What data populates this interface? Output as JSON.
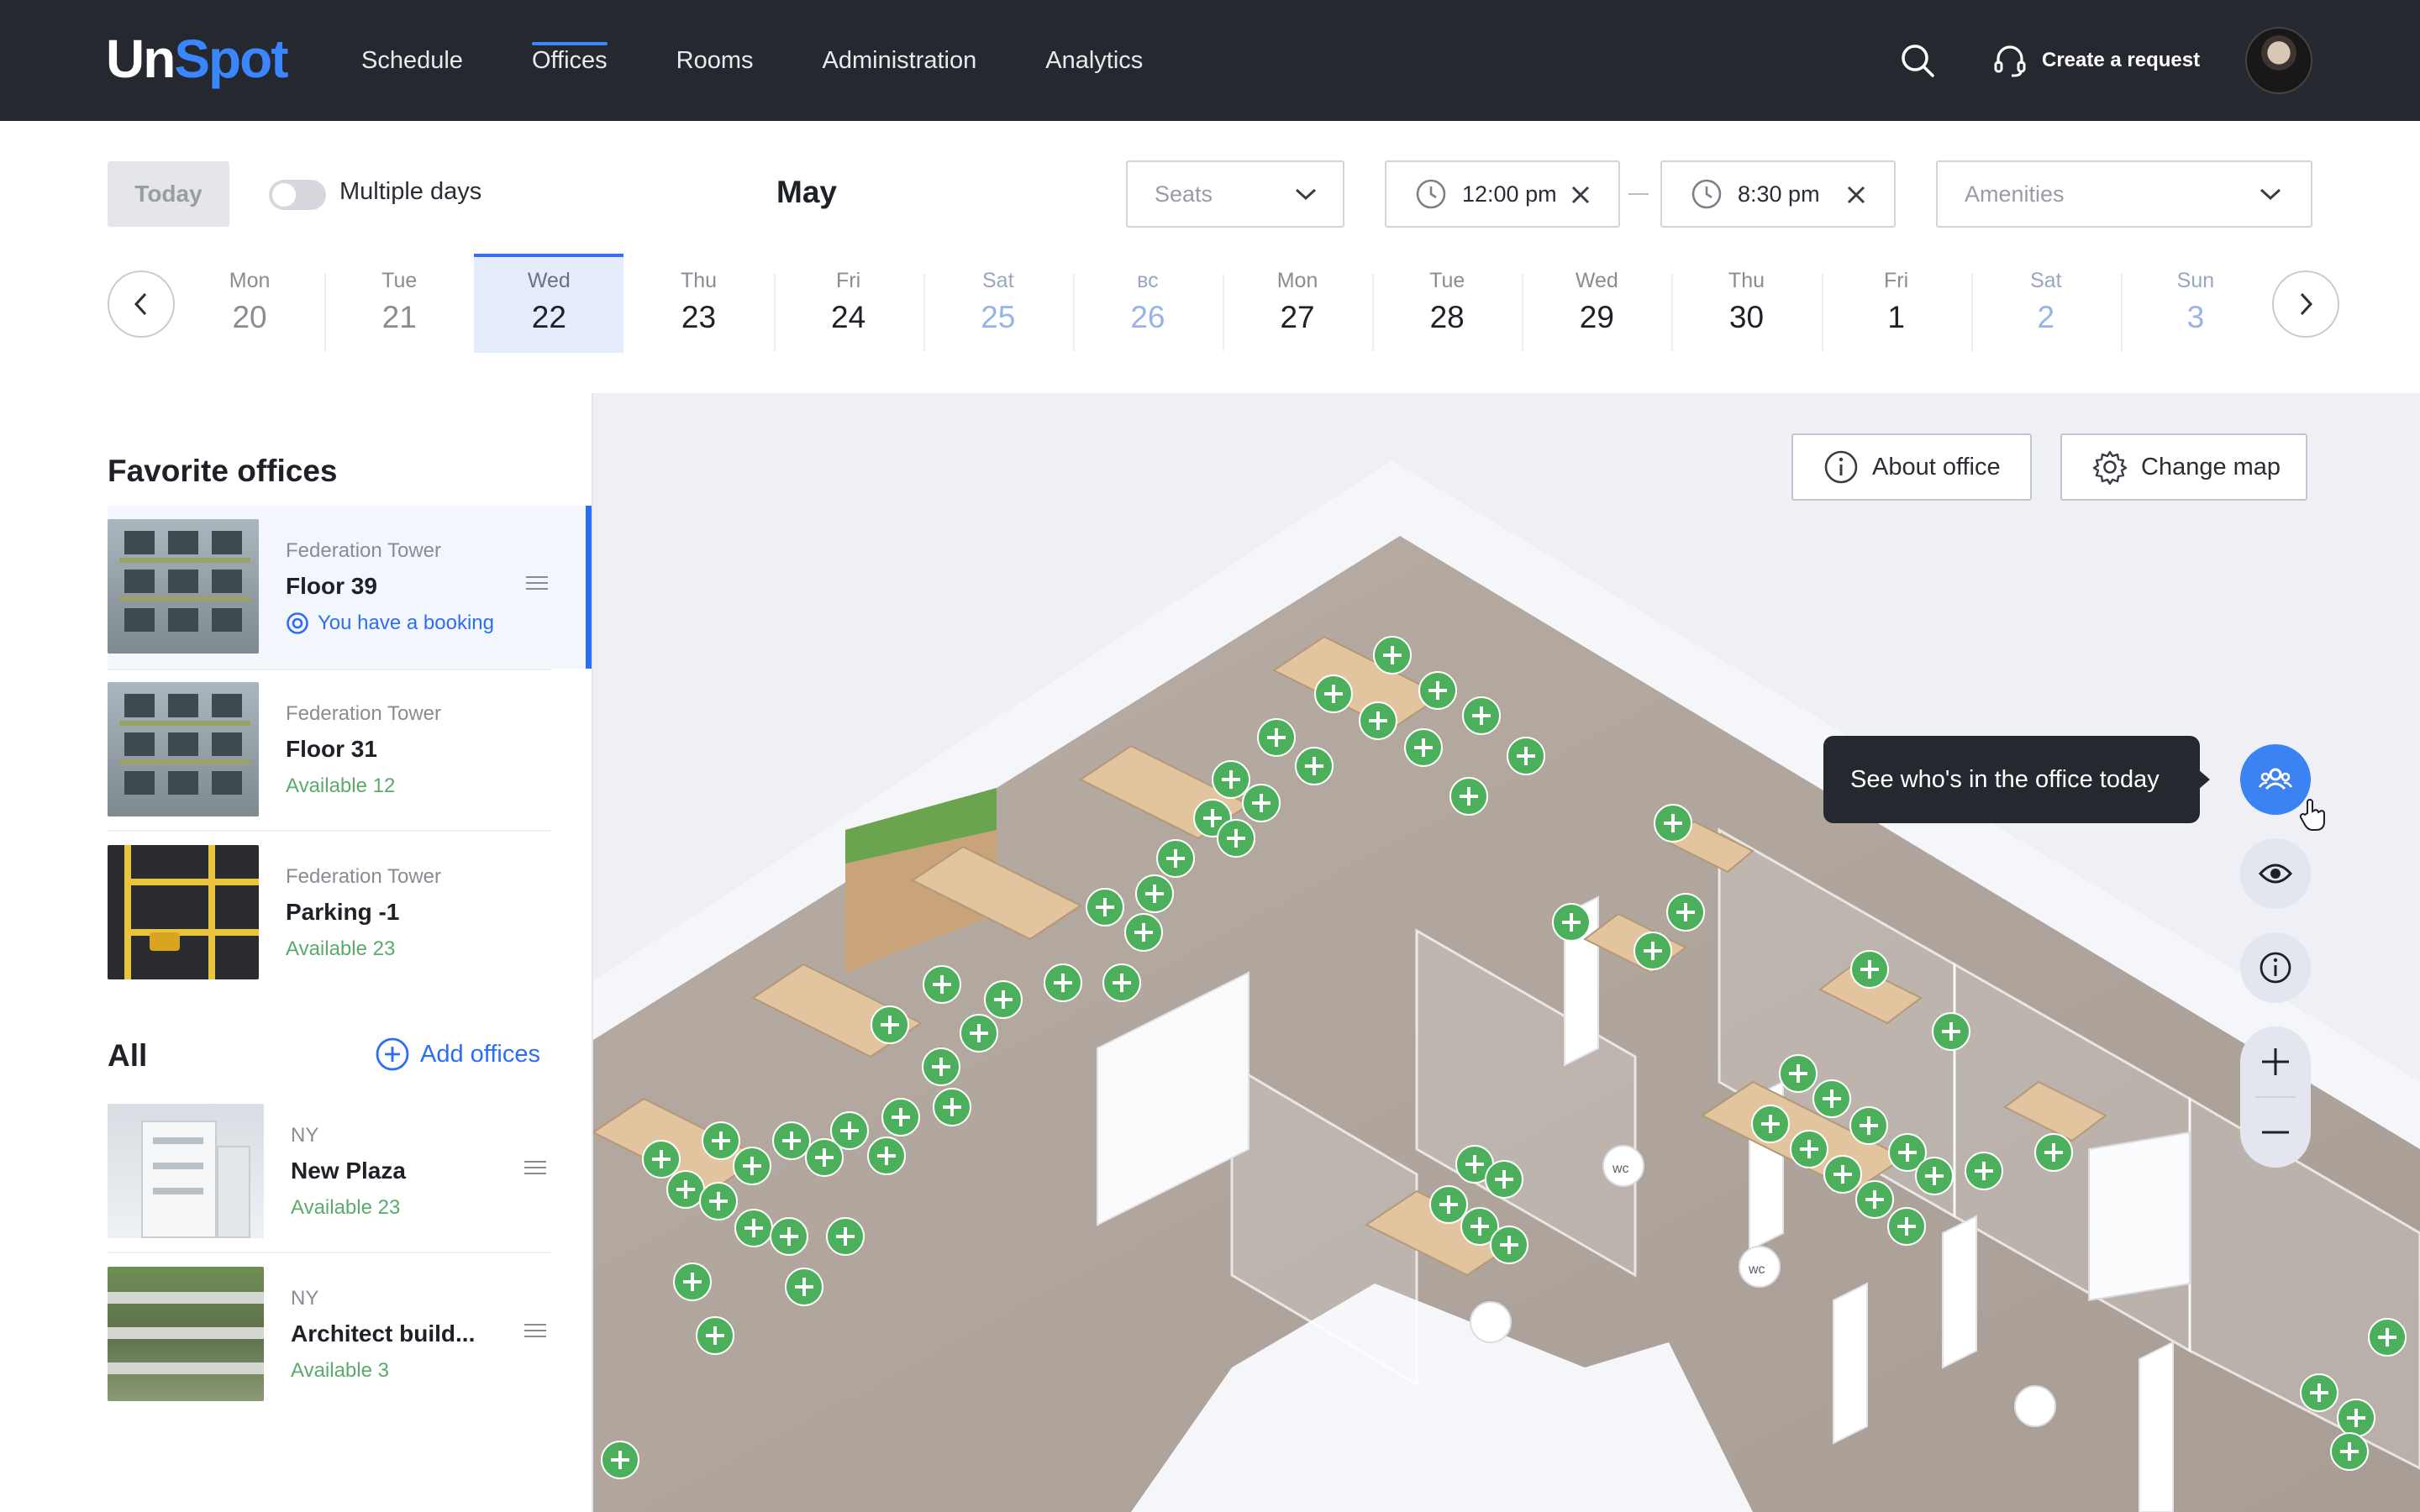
{
  "brand": {
    "logo_part1": "Un",
    "logo_part2": "Spot",
    "accent": "#3a86ff"
  },
  "nav": {
    "items": [
      {
        "label": "Schedule",
        "active": false
      },
      {
        "label": "Offices",
        "active": true
      },
      {
        "label": "Rooms",
        "active": false
      },
      {
        "label": "Administration",
        "active": false
      },
      {
        "label": "Analytics",
        "active": false
      }
    ],
    "search_icon": "search-icon",
    "create_request": "Create a request",
    "headset_icon": "headset-icon"
  },
  "filters": {
    "today": "Today",
    "multiple_days": "Multiple days",
    "multiple_days_on": false,
    "month": "May",
    "seats_placeholder": "Seats",
    "time_from": "12:00 pm",
    "time_to": "8:30 pm",
    "amenities_placeholder": "Amenities"
  },
  "days": [
    {
      "name": "Mon",
      "date": "20",
      "state": "past"
    },
    {
      "name": "Tue",
      "date": "21",
      "state": "past"
    },
    {
      "name": "Wed",
      "date": "22",
      "state": "selected"
    },
    {
      "name": "Thu",
      "date": "23",
      "state": "normal"
    },
    {
      "name": "Fri",
      "date": "24",
      "state": "normal"
    },
    {
      "name": "Sat",
      "date": "25",
      "state": "weekend"
    },
    {
      "name": "вс",
      "date": "26",
      "state": "weekend"
    },
    {
      "name": "Mon",
      "date": "27",
      "state": "normal"
    },
    {
      "name": "Tue",
      "date": "28",
      "state": "normal"
    },
    {
      "name": "Wed",
      "date": "29",
      "state": "normal"
    },
    {
      "name": "Thu",
      "date": "30",
      "state": "normal"
    },
    {
      "name": "Fri",
      "date": "1",
      "state": "normal"
    },
    {
      "name": "Sat",
      "date": "2",
      "state": "weekend"
    },
    {
      "name": "Sun",
      "date": "3",
      "state": "weekend"
    }
  ],
  "sidebar": {
    "favorites_title": "Favorite offices",
    "favorites": [
      {
        "building": "Federation Tower",
        "name": "Floor 39",
        "status": "You have a booking",
        "booked": true
      },
      {
        "building": "Federation Tower",
        "name": "Floor 31",
        "status": "Available 12",
        "booked": false
      },
      {
        "building": "Federation Tower",
        "name": "Parking -1",
        "status": "Available 23",
        "booked": false
      }
    ],
    "all_title": "All",
    "add_offices": "Add offices",
    "all": [
      {
        "building": "NY",
        "name": "New Plaza",
        "status": "Available 23"
      },
      {
        "building": "NY",
        "name": "Architect build...",
        "status": "Available 3"
      }
    ]
  },
  "map": {
    "about_office": "About office",
    "change_map": "Change map",
    "tooltip": "See who's in the office today",
    "tools": [
      "people-icon",
      "eye-icon",
      "info-icon",
      "zoom-in-icon",
      "zoom-out-icon"
    ],
    "seat_color": "#4caf5c",
    "wc_label": "wc"
  }
}
